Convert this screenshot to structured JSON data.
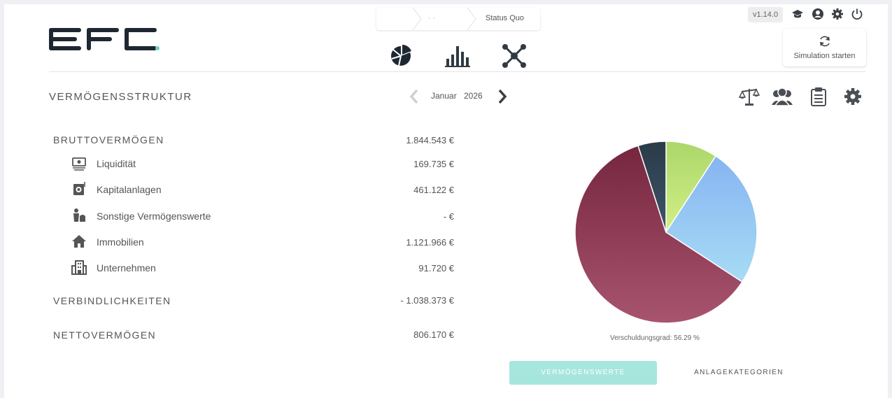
{
  "breadcrumb": {
    "items": [
      "",
      "· ·",
      "Status Quo"
    ]
  },
  "header": {
    "version": "v1.14.0",
    "simulation_label": "Simulation starten"
  },
  "section": {
    "title": "VERMÖGENSSTRUKTUR"
  },
  "period": {
    "month": "Januar",
    "year": "2026"
  },
  "assets": {
    "gross": {
      "label": "BRUTTOVERMÖGEN",
      "value": "1.844.543 €"
    },
    "items": [
      {
        "label": "Liquidität",
        "value": "169.735 €",
        "icon": "cash-icon"
      },
      {
        "label": "Kapitalanlagen",
        "value": "461.122 €",
        "icon": "investment-icon"
      },
      {
        "label": "Sonstige Vermögenswerte",
        "value": "- €",
        "icon": "valuables-icon"
      },
      {
        "label": "Immobilien",
        "value": "1.121.966 €",
        "icon": "house-icon"
      },
      {
        "label": "Unternehmen",
        "value": "91.720 €",
        "icon": "building-icon"
      }
    ],
    "liabilities": {
      "label": "VERBINDLICHKEITEN",
      "value": "- 1.038.373 €"
    },
    "net": {
      "label": "NETTOVERMÖGEN",
      "value": "806.170 €"
    }
  },
  "chart_data": {
    "type": "pie",
    "slices": [
      {
        "label": "Liquidität",
        "value": 169735,
        "color": "#b5dc6e"
      },
      {
        "label": "Kapitalanlagen",
        "value": 461122,
        "color": "#8fbdf3"
      },
      {
        "label": "Immobilien",
        "value": 1121966,
        "color": "#8c3b55"
      },
      {
        "label": "Unternehmen",
        "value": 91720,
        "color": "#2f4454"
      }
    ]
  },
  "debt_ratio": "Verschuldungsgrad: 56.29 %",
  "tabs": {
    "active": "VERMÖGENSWERTE",
    "inactive": "ANLAGEKATEGORIEN"
  },
  "colors": {
    "accent": "#a6e6dd",
    "brand_dark": "#1f2733",
    "brand_dot": "#6fd3c4"
  }
}
